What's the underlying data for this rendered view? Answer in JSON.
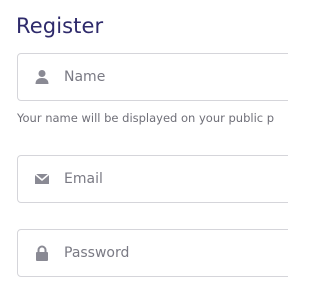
{
  "form": {
    "title": "Register",
    "name": {
      "placeholder": "Name",
      "value": "",
      "icon": "user-icon",
      "hint": "Your name will be displayed on your public p"
    },
    "email": {
      "placeholder": "Email",
      "value": "",
      "icon": "envelope-icon"
    },
    "password": {
      "placeholder": "Password",
      "value": "",
      "icon": "lock-icon"
    }
  },
  "colors": {
    "title": "#2e2a6b",
    "icon": "#8a8a94",
    "border": "#d5d5da",
    "placeholder": "#7a7a84",
    "hint": "#6f6f78"
  }
}
